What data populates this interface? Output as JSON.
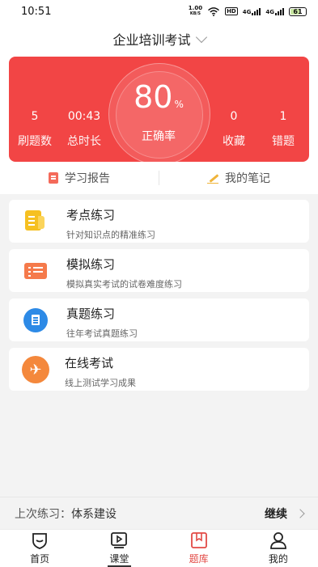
{
  "status_bar": {
    "time": "10:51",
    "net_speed_value": "1.00",
    "net_speed_unit": "KB/S",
    "hd": "HD",
    "signal1": "4G",
    "signal2": "4G",
    "battery": "61"
  },
  "header": {
    "title": "企业培训考试"
  },
  "stats": {
    "questions_value": "5",
    "questions_label": "刷题数",
    "duration_value": "00:43",
    "duration_label": "总时长",
    "accuracy_value": "80",
    "accuracy_unit": "%",
    "accuracy_label": "正确率",
    "favorites_value": "0",
    "favorites_label": "收藏",
    "wrong_value": "1",
    "wrong_label": "错题",
    "accent_color": "#f24545"
  },
  "links": {
    "report": "学习报告",
    "notes": "我的笔记"
  },
  "practice_cards": [
    {
      "title": "考点练习",
      "subtitle": "针对知识点的精准练习",
      "icon": "notebook-icon",
      "color": "#f6c021"
    },
    {
      "title": "模拟练习",
      "subtitle": "模拟真实考试的试卷难度练习",
      "icon": "list-icon",
      "color": "#f57a4b"
    },
    {
      "title": "真题练习",
      "subtitle": "往年考试真题练习",
      "icon": "book-icon",
      "color": "#2d8ae6"
    },
    {
      "title": "在线考试",
      "subtitle": "线上测试学习成果",
      "icon": "airplane-icon",
      "color": "#f4883c"
    }
  ],
  "last_practice": {
    "label": "上次练习：",
    "value": "体系建设",
    "action": "继续"
  },
  "tabbar": {
    "items": [
      {
        "label": "首页",
        "icon": "home-shield-icon"
      },
      {
        "label": "课堂",
        "icon": "play-screen-icon"
      },
      {
        "label": "题库",
        "icon": "question-bank-icon",
        "active": true
      },
      {
        "label": "我的",
        "icon": "person-icon"
      }
    ],
    "active_color": "#e24a45"
  }
}
